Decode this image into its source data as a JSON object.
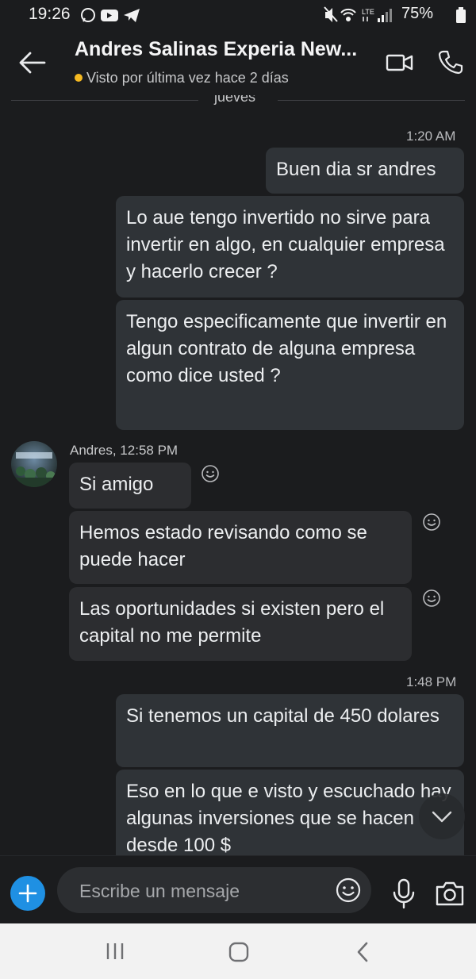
{
  "status_bar": {
    "time": "19:26",
    "battery": "75%",
    "network": "LTE"
  },
  "header": {
    "title": "Andres Salinas Experia New...",
    "presence": "Visto por última vez hace 2 días",
    "presence_color": "#f5b921"
  },
  "chat": {
    "day_divider": "jueves",
    "messages": [
      {
        "direction": "out",
        "time": "1:20 AM",
        "text": "Buen dia sr andres"
      },
      {
        "direction": "out",
        "text": "Lo aue tengo invertido no sirve para invertir en algo, en cualquier empresa y hacerlo crecer ?"
      },
      {
        "direction": "out",
        "text": "Tengo especificamente que invertir en algun contrato de alguna empresa como dice usted ?"
      },
      {
        "direction": "in",
        "sender_line": "Andres, 12:58 PM",
        "text": "Si amigo"
      },
      {
        "direction": "in",
        "text": "Hemos estado revisando como se puede hacer"
      },
      {
        "direction": "in",
        "text": "Las oportunidades si existen pero el capital no me permite"
      },
      {
        "direction": "out",
        "time": "1:48 PM",
        "text": "Si tenemos un capital de 450 dolares"
      },
      {
        "direction": "out",
        "text": "Eso en lo que e visto y escuchado hay algunas inversiones que se hacen desde 100 $"
      }
    ]
  },
  "composer": {
    "placeholder": "Escribe un mensaje"
  },
  "icons": {
    "back": "arrow-left-icon",
    "video": "video-camera-icon",
    "call": "phone-icon",
    "add": "plus-icon",
    "emoji": "smiley-icon",
    "mic": "microphone-icon",
    "camera": "camera-icon",
    "scroll": "chevron-down-icon"
  },
  "colors": {
    "background": "#1b1c1e",
    "bubble_out": "#2f3337",
    "bubble_in": "#2c2d30",
    "accent": "#1f90e3"
  }
}
